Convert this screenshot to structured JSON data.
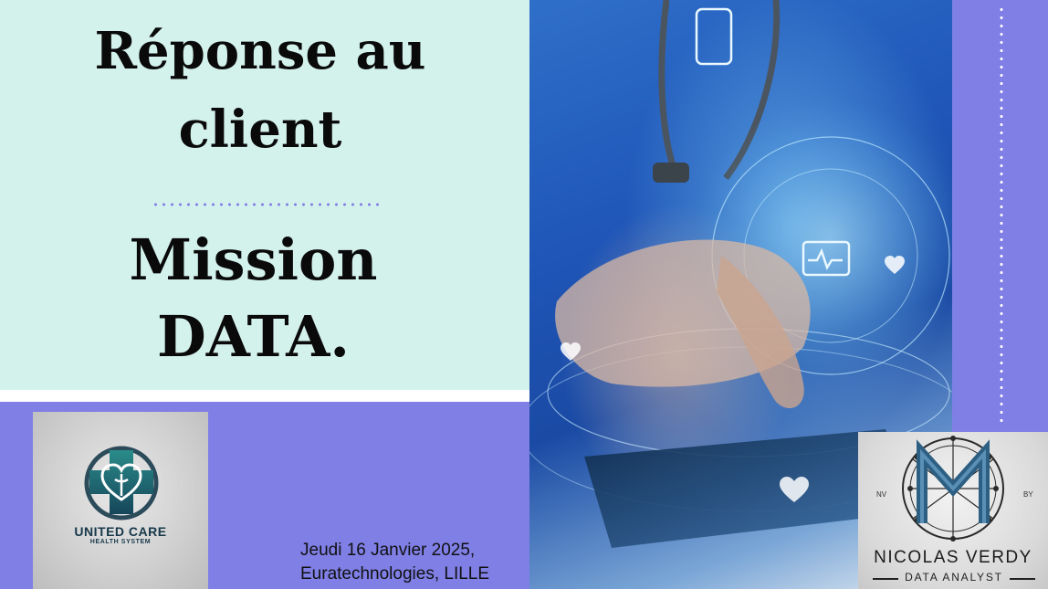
{
  "slide": {
    "title_line_1": "Réponse au",
    "title_line_2": "client",
    "subtitle_line_1": "Mission",
    "subtitle_line_2": "DATA.",
    "date": "Jeudi 16 Janvier 2025,",
    "location": "Euratechnologies, LILLE"
  },
  "client_logo": {
    "name": "UNITED CARE",
    "tagline": "HEALTH SYSTEM",
    "icon": "medical-cross-heart-icon"
  },
  "analyst_logo": {
    "left_initials": "NV",
    "right_initials": "BY",
    "name": "NICOLAS VERDY",
    "role": "DATA ANALYST",
    "icon": "network-monogram-icon"
  },
  "photo": {
    "icon": "doctor-tablet-photo"
  },
  "colors": {
    "mint": "#d4f2ec",
    "lavender": "#7f7fe6",
    "blue": "#1f56b8",
    "teal": "#1e6a70"
  }
}
